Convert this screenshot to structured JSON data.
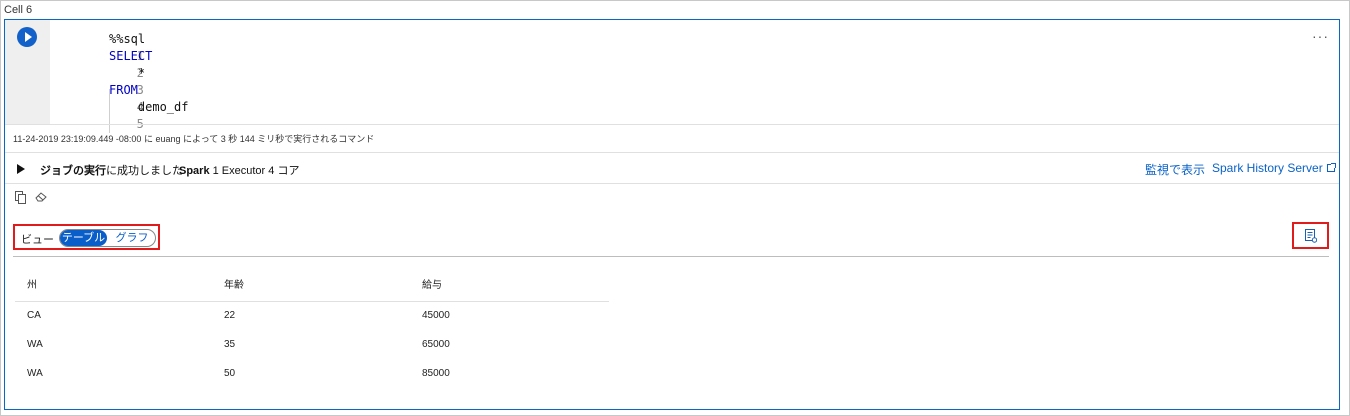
{
  "cell": {
    "title": "Cell 6"
  },
  "editor": {
    "more_label": "···",
    "lines": [
      {
        "num": "1",
        "text": "%%sql"
      },
      {
        "num": "2",
        "text": "SELECT"
      },
      {
        "num": "3",
        "text": "    *"
      },
      {
        "num": "4",
        "text": "FROM"
      },
      {
        "num": "5",
        "text": "    demo_df"
      }
    ]
  },
  "execution": {
    "info": "11-24-2019 23:19:09.449 -08:00 に euang によって 3 秒 144 ミリ秒で実行されるコマンド"
  },
  "job": {
    "status_bold": "ジョブの実行",
    "status_rest": "に成功しました",
    "spark_bold": "Spark",
    "spark_rest": " 1 Executor 4 コア",
    "monitor_link": "監視で表示",
    "history_link": "Spark History Server"
  },
  "view": {
    "label": "ビュー",
    "options": [
      "テーブル",
      "グラフ"
    ],
    "selected": "テーブル"
  },
  "table": {
    "headers": [
      "州",
      "年齢",
      "給与"
    ],
    "rows": [
      [
        "CA",
        "22",
        "45000"
      ],
      [
        "WA",
        "35",
        "65000"
      ],
      [
        "WA",
        "50",
        "85000"
      ]
    ]
  },
  "colors": {
    "accent": "#0a5ec9",
    "highlight_box": "#e01b1b"
  }
}
